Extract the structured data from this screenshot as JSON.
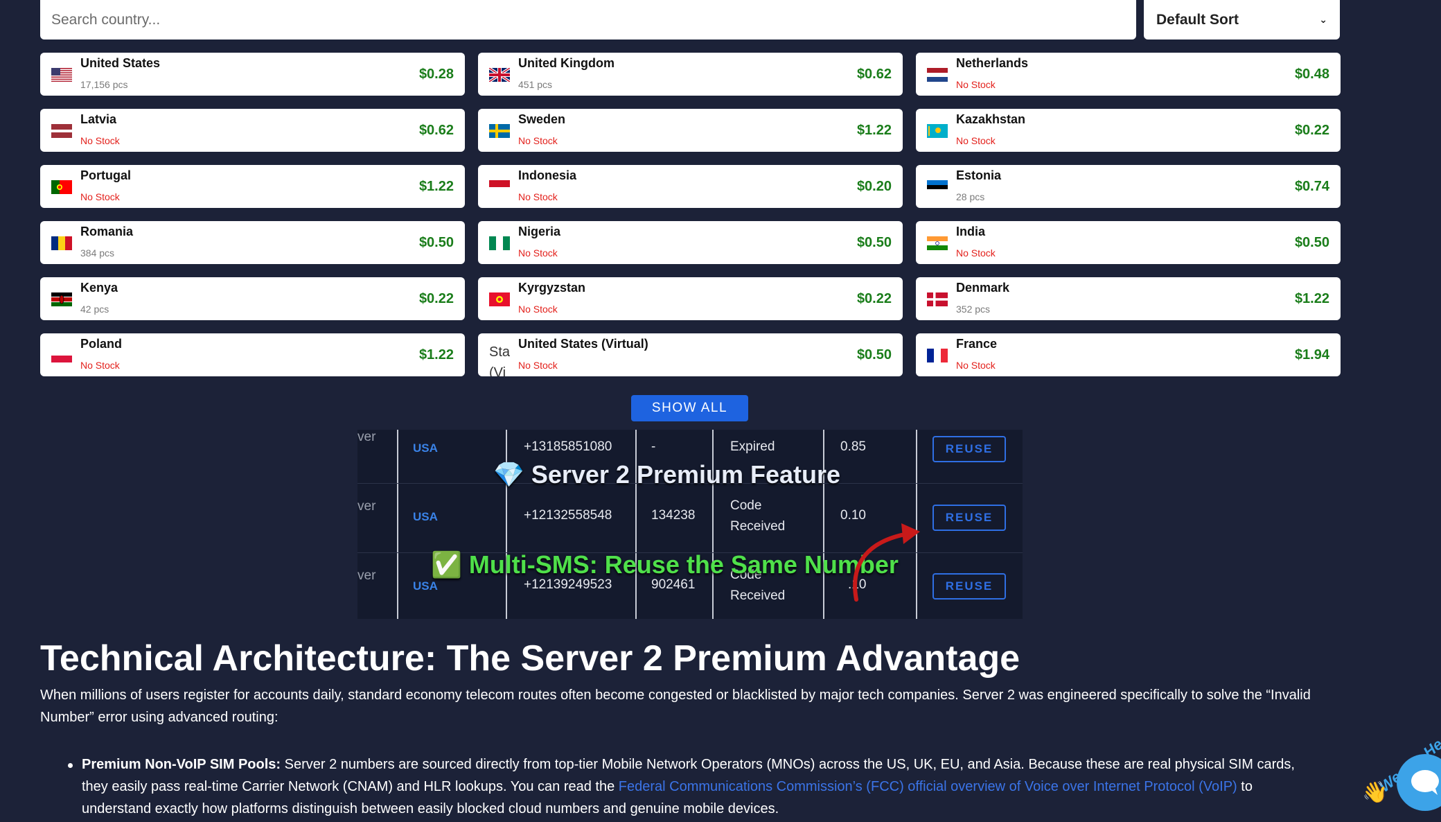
{
  "search": {
    "placeholder": "Search country..."
  },
  "sort": {
    "selected": "Default Sort"
  },
  "countries": [
    {
      "name": "United States",
      "stock": "17,156 pcs",
      "in_stock": true,
      "price": "$0.28",
      "flag": "us"
    },
    {
      "name": "United Kingdom",
      "stock": "451 pcs",
      "in_stock": true,
      "price": "$0.62",
      "flag": "uk"
    },
    {
      "name": "Netherlands",
      "stock": "No Stock",
      "in_stock": false,
      "price": "$0.48",
      "flag": "nl"
    },
    {
      "name": "Latvia",
      "stock": "No Stock",
      "in_stock": false,
      "price": "$0.62",
      "flag": "lv"
    },
    {
      "name": "Sweden",
      "stock": "No Stock",
      "in_stock": false,
      "price": "$1.22",
      "flag": "se"
    },
    {
      "name": "Kazakhstan",
      "stock": "No Stock",
      "in_stock": false,
      "price": "$0.22",
      "flag": "kz"
    },
    {
      "name": "Portugal",
      "stock": "No Stock",
      "in_stock": false,
      "price": "$1.22",
      "flag": "pt"
    },
    {
      "name": "Indonesia",
      "stock": "No Stock",
      "in_stock": false,
      "price": "$0.20",
      "flag": "id"
    },
    {
      "name": "Estonia",
      "stock": "28 pcs",
      "in_stock": true,
      "price": "$0.74",
      "flag": "ee"
    },
    {
      "name": "Romania",
      "stock": "384 pcs",
      "in_stock": true,
      "price": "$0.50",
      "flag": "ro"
    },
    {
      "name": "Nigeria",
      "stock": "No Stock",
      "in_stock": false,
      "price": "$0.50",
      "flag": "ng"
    },
    {
      "name": "India",
      "stock": "No Stock",
      "in_stock": false,
      "price": "$0.50",
      "flag": "in"
    },
    {
      "name": "Kenya",
      "stock": "42 pcs",
      "in_stock": true,
      "price": "$0.22",
      "flag": "ke"
    },
    {
      "name": "Kyrgyzstan",
      "stock": "No Stock",
      "in_stock": false,
      "price": "$0.22",
      "flag": "kg"
    },
    {
      "name": "Denmark",
      "stock": "352 pcs",
      "in_stock": true,
      "price": "$1.22",
      "flag": "dk"
    },
    {
      "name": "Poland",
      "stock": "No Stock",
      "in_stock": false,
      "price": "$1.22",
      "flag": "pl"
    },
    {
      "name": "United States (Virtual)",
      "stock": "No Stock",
      "in_stock": false,
      "price": "$0.50",
      "flag": "broken",
      "alt": "Sta (Vi"
    },
    {
      "name": "France",
      "stock": "No Stock",
      "in_stock": false,
      "price": "$1.94",
      "flag": "fr"
    }
  ],
  "show_all_label": "SHOW ALL",
  "promo": {
    "title": "💎 Server 2 Premium Feature",
    "subtitle": "✅ Multi-SMS: Reuse the Same Number",
    "col_cut_label": "ver",
    "reuse_label": "REUSE",
    "rows": [
      {
        "country": "USA",
        "number": "+13185851080",
        "code": "-",
        "status_line1": "Expired",
        "status_line2": "",
        "price": "0.85"
      },
      {
        "country": "USA",
        "number": "+12132558548",
        "code": "134238",
        "status_line1": "Code",
        "status_line2": "Received",
        "price": "0.10"
      },
      {
        "country": "USA",
        "number": "+12139249523",
        "code": "902461",
        "status_line1": "Code",
        "status_line2": "Received",
        "price": ".10"
      }
    ]
  },
  "article": {
    "heading": "Technical Architecture: The Server 2 Premium Advantage",
    "intro": "When millions of users register for accounts daily, standard economy telecom routes often become congested or blacklisted by major tech companies. Server 2 was engineered specifically to solve the “Invalid Number” error using advanced routing:",
    "bullet_title": "Premium Non-VoIP SIM Pools:",
    "bullet_text_1": " Server 2 numbers are sourced directly from top-tier Mobile Network Operators (MNOs) across the US, UK, EU, and Asia. Because these are real physical SIM cards, they easily pass real-time Carrier Network (CNAM) and HLR lookups. You can read the ",
    "bullet_link": "Federal Communications Commission’s (FCC) official overview of Voice over Internet Protocol (VoIP)",
    "bullet_text_2": " to understand exactly how platforms distinguish between easily blocked cloud numbers and genuine mobile devices."
  },
  "chat": {
    "label": "We Are He"
  }
}
